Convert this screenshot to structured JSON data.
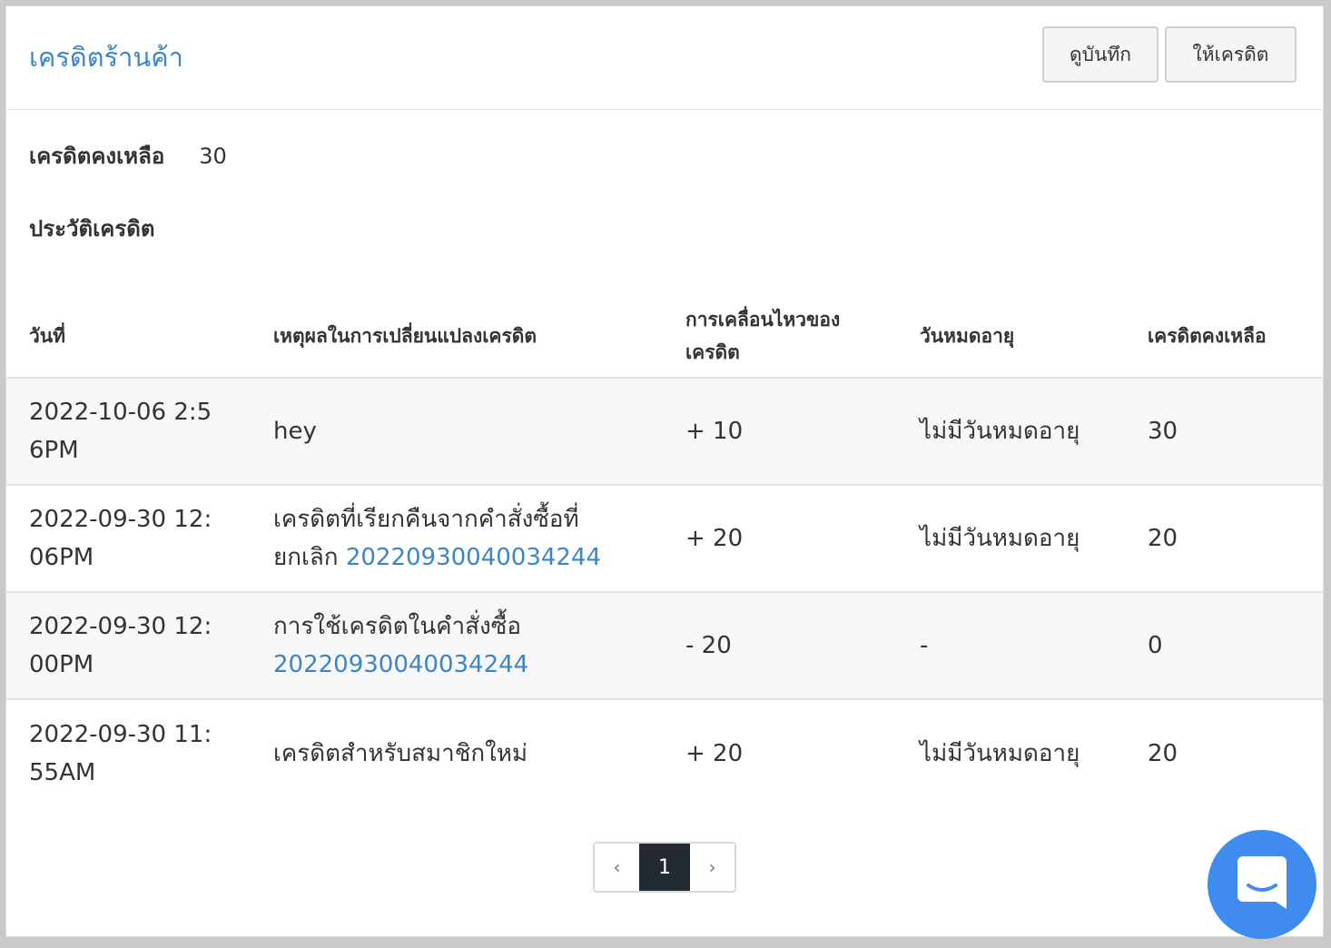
{
  "header": {
    "title": "เครดิตร้านค้า",
    "view_log_label": "ดูบันทึก",
    "give_credit_label": "ให้เครดิต"
  },
  "balance": {
    "label": "เครดิตคงเหลือ",
    "value": "30"
  },
  "history": {
    "title": "ประวัติเครดิต",
    "columns": {
      "date": "วันที่",
      "reason": "เหตุผลในการเปลี่ยนแปลงเครดิต",
      "movement_line1": "การเคลื่อนไหวของ",
      "movement_line2": "เครดิต",
      "expiry": "วันหมดอายุ",
      "balance": "เครดิตคงเหลือ"
    },
    "rows": [
      {
        "date_line1": "2022-10-06 2:5",
        "date_line2": "6PM",
        "reason_text": "hey",
        "reason_link": "",
        "movement": "+ 10",
        "expiry": "ไม่มีวันหมดอายุ",
        "balance": "30"
      },
      {
        "date_line1": "2022-09-30 12:",
        "date_line2": "06PM",
        "reason_text": "เครดิตที่เรียกคืนจากคำสั่งซื้อที่ยกเลิก ",
        "reason_link": "20220930040034244",
        "movement": "+ 20",
        "expiry": "ไม่มีวันหมดอายุ",
        "balance": "20"
      },
      {
        "date_line1": "2022-09-30 12:",
        "date_line2": "00PM",
        "reason_text": "การใช้เครดิตในคำสั่งซื้อ ",
        "reason_link": "20220930040034244",
        "movement": "- 20",
        "expiry": "-",
        "balance": "0"
      },
      {
        "date_line1": "2022-09-30 11:",
        "date_line2": "55AM",
        "reason_text": "เครดิตสำหรับสมาชิกใหม่",
        "reason_link": "",
        "movement": "+ 20",
        "expiry": "ไม่มีวันหมดอายุ",
        "balance": "20"
      }
    ]
  },
  "pagination": {
    "prev": "‹",
    "current": "1",
    "next": "›"
  },
  "colors": {
    "accent": "#3a86c8",
    "chat_button": "#3f8cee",
    "active_page": "#232a31"
  },
  "icons": {
    "chat": "chat-bubble-icon"
  }
}
